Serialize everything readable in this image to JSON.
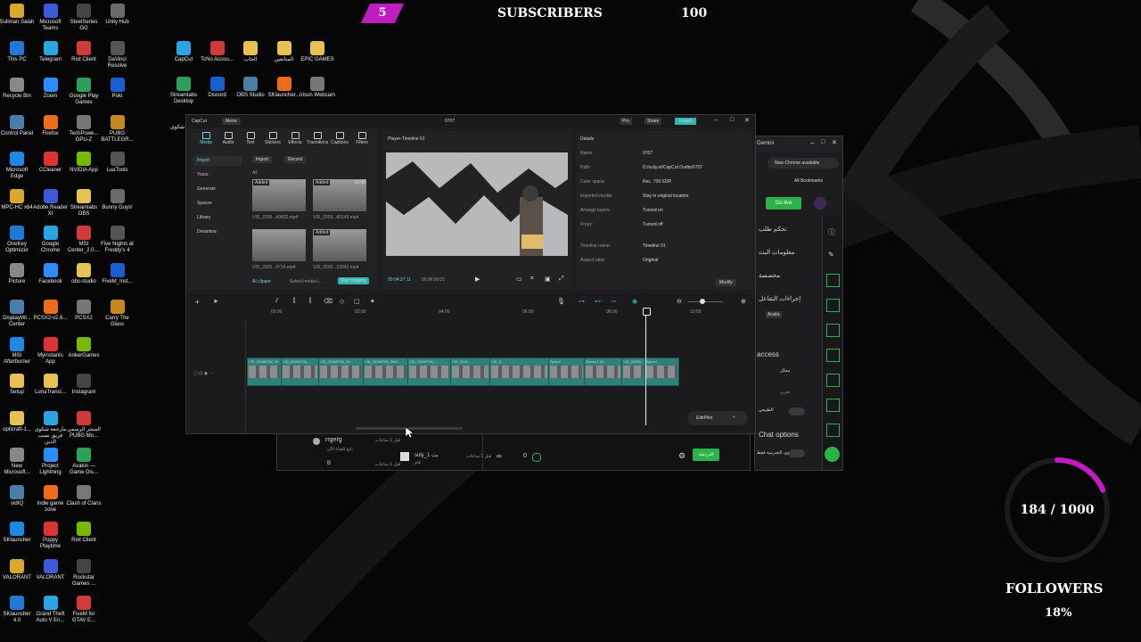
{
  "overlay": {
    "badge_count": "5",
    "subscribers_label": "SUBSCRIBERS",
    "subscribers_value": "100",
    "followers_progress": "184 / 1000",
    "followers_label": "FOLLOWERS",
    "followers_percent": "18%",
    "followers_fraction": 0.184,
    "accent_color": "#c01dc0"
  },
  "desktop": {
    "icons": [
      {
        "label": "Suliman Salah",
        "icon": "user-folder-icon"
      },
      {
        "label": "Microsoft Teams",
        "icon": "teams-icon"
      },
      {
        "label": "SteelSeries GG",
        "icon": "steelseries-icon"
      },
      {
        "label": "Unity Hub",
        "icon": "unity-icon"
      },
      {
        "label": "This PC",
        "icon": "pc-icon"
      },
      {
        "label": "Telegram",
        "icon": "telegram-icon"
      },
      {
        "label": "Riot Client",
        "icon": "riot-icon"
      },
      {
        "label": "DaVinci Resolve",
        "icon": "davinci-icon"
      },
      {
        "label": "Recycle Bin",
        "icon": "recycle-bin-icon"
      },
      {
        "label": "Zoom",
        "icon": "zoom-icon"
      },
      {
        "label": "Google Play Games",
        "icon": "play-games-icon"
      },
      {
        "label": "Poki",
        "icon": "poki-icon"
      },
      {
        "label": "Control Panel",
        "icon": "control-panel-icon"
      },
      {
        "label": "Firefox",
        "icon": "firefox-icon"
      },
      {
        "label": "TechPowe... GPU-Z",
        "icon": "gpuz-icon"
      },
      {
        "label": "PUBG BATTLEGR...",
        "icon": "pubg-icon"
      },
      {
        "label": "Microsoft Edge",
        "icon": "edge-icon"
      },
      {
        "label": "CCleaner",
        "icon": "ccleaner-icon"
      },
      {
        "label": "NVIDIA App",
        "icon": "nvidia-icon"
      },
      {
        "label": "LuaTools",
        "icon": "luatools-icon"
      },
      {
        "label": "MPC-HC x64",
        "icon": "mpc-icon"
      },
      {
        "label": "Adobe Reader XI",
        "icon": "adobe-icon"
      },
      {
        "label": "Streamlabs OBS",
        "icon": "folder-icon"
      },
      {
        "label": "Bunny Guys!",
        "icon": "game-icon"
      },
      {
        "label": "OneKey Optimizer",
        "icon": "onekey-icon"
      },
      {
        "label": "Google Chrome",
        "icon": "chrome-icon"
      },
      {
        "label": "MSI Center_2.0....",
        "icon": "msi-icon"
      },
      {
        "label": "Five Nights at Freddy's 4",
        "icon": "fnaf-icon"
      },
      {
        "label": "Picture",
        "icon": "picture-icon"
      },
      {
        "label": "Facebook",
        "icon": "facebook-icon"
      },
      {
        "label": "obs-studio",
        "icon": "folder-icon"
      },
      {
        "label": "FiveM_Inst...",
        "icon": "fivem-icon"
      },
      {
        "label": "DisplayWi... Center",
        "icon": "display-icon"
      },
      {
        "label": "PCSX2-v2.6...",
        "icon": "pcsx2-icon"
      },
      {
        "label": "PCSX2",
        "icon": "pcsx2-icon"
      },
      {
        "label": "Carry The Glass",
        "icon": "game-icon"
      },
      {
        "label": "MSI Afterburner",
        "icon": "afterburner-icon"
      },
      {
        "label": "Myinstants App",
        "icon": "myinstants-icon"
      },
      {
        "label": "AnkerGames",
        "icon": "anker-icon"
      },
      {
        "label": "",
        "icon": "blank"
      },
      {
        "label": "Setup",
        "icon": "folder-icon"
      },
      {
        "label": "LunaTransl...",
        "icon": "folder-icon"
      },
      {
        "label": "Instagram",
        "icon": "instagram-icon"
      },
      {
        "label": "",
        "icon": "blank"
      },
      {
        "label": "opticraft-1...",
        "icon": "folder-icon"
      },
      {
        "label": "مارجعة شكوى فريق نسب الدين",
        "icon": "document-icon"
      },
      {
        "label": "المتجر الرسمي PUBG Mo...",
        "icon": "pubg-icon"
      },
      {
        "label": "",
        "icon": "blank"
      },
      {
        "label": "New Microsoft...",
        "icon": "document-icon"
      },
      {
        "label": "Project Lightning",
        "icon": "project-icon"
      },
      {
        "label": "Avakin — Game Dis...",
        "icon": "avakin-icon"
      },
      {
        "label": "",
        "icon": "blank"
      },
      {
        "label": "vidIQ",
        "icon": "vidiq-icon"
      },
      {
        "label": "indie game zone",
        "icon": "indie-icon"
      },
      {
        "label": "Clash of Clans",
        "icon": "coc-icon"
      },
      {
        "label": "",
        "icon": "blank"
      },
      {
        "label": "SKlauncher",
        "icon": "sklauncher-icon"
      },
      {
        "label": "Poppy Playtime",
        "icon": "poppy-icon"
      },
      {
        "label": "Riot Client",
        "icon": "riot-icon"
      },
      {
        "label": "",
        "icon": "blank"
      },
      {
        "label": "VALORANT",
        "icon": "valorant-icon"
      },
      {
        "label": "VALORANT",
        "icon": "valorant-icon"
      },
      {
        "label": "Rockstar Games ...",
        "icon": "rockstar-icon"
      },
      {
        "label": "",
        "icon": "blank"
      },
      {
        "label": "SKlauncher 4.0",
        "icon": "sklauncher-icon"
      },
      {
        "label": "Grand Theft Auto V En...",
        "icon": "gta-icon"
      },
      {
        "label": "FiveM for GTAV E...",
        "icon": "fivem-icon"
      }
    ],
    "icons2": [
      {
        "label": "CapCut",
        "icon": "capcut-icon"
      },
      {
        "label": "TcNo Accou...",
        "icon": "tcno-icon"
      },
      {
        "label": "الحاب",
        "icon": "folder-icon"
      },
      {
        "label": "المتابعين",
        "icon": "folder-icon"
      },
      {
        "label": "EPIC GAMES",
        "icon": "folder-icon"
      },
      {
        "label": "Streamlabs Desktop",
        "icon": "streamlabs-icon"
      },
      {
        "label": "Discord",
        "icon": "discord-icon"
      },
      {
        "label": "OBS Studio",
        "icon": "obs-icon"
      },
      {
        "label": "SKlauncher...",
        "icon": "sklauncher-icon"
      },
      {
        "label": "Irisun Webcam",
        "icon": "webcam-icon"
      }
    ],
    "partial_icon_label": "شكوى"
  },
  "capcut": {
    "app_name": "CapCut",
    "menu": "Menu",
    "project_title": "0707",
    "pro": "Pro",
    "share": "Share",
    "export": "Export",
    "toolbar": [
      "Media",
      "Audio",
      "Text",
      "Stickers",
      "Effects",
      "Transitions",
      "Captions",
      "Filters"
    ],
    "side_menu": [
      "Import",
      "Yours",
      "Generate",
      "Spaces",
      "Library",
      "Dreamina"
    ],
    "import_btn": "Import",
    "record_btn": "Record",
    "all_label": "All",
    "media": [
      {
        "name": "VID_2026...49602.mp4",
        "added": "Added",
        "dur": ""
      },
      {
        "name": "VID_2026...85149.mp4",
        "added": "Added",
        "dur": "00:08"
      },
      {
        "name": "VID_2026...9714.mp4",
        "added": "",
        "dur": ""
      },
      {
        "name": "VID_2026...19942.mp4",
        "added": "Added",
        "dur": ""
      }
    ],
    "ai_clipper": "AI clipper",
    "select_media": "Select media t...",
    "start_clipping": "Start clipping",
    "player_title": "Player-Timeline 01",
    "time_current": "00:04:27:11",
    "time_total": "00:06:50:21",
    "details_title": "Details",
    "details": [
      {
        "k": "Name:",
        "v": "0707"
      },
      {
        "k": "Path:",
        "v": "D:/suliy.et/CapCut Drafts/0707"
      },
      {
        "k": "Color space:",
        "v": "Rec. 709 SDR"
      },
      {
        "k": "Imported media:",
        "v": "Stay in original location"
      },
      {
        "k": "Arrange layers:",
        "v": "Turned on"
      },
      {
        "k": "Proxy:",
        "v": "Turned off"
      },
      {
        "k": "Timeline name:",
        "v": "Timeline 01"
      },
      {
        "k": "Aspect ratio:",
        "v": "Original"
      }
    ],
    "modify_btn": "Modify",
    "ruler": [
      "00:00",
      "02:00",
      "04:00",
      "06:00",
      "08:00",
      "10:00"
    ],
    "clips": [
      "VID_20260706_00...",
      "VID_20260706_...",
      "VID_20260706_00...",
      "VID_20260706_2801",
      "VID_20260706_...",
      "VID_2026...",
      "VID_2...",
      "Speed",
      "Speed 1.0X",
      "VID_20260...",
      "Speed"
    ],
    "editpilot": "EditPilot"
  },
  "chrome": {
    "tab_label": "Gemini",
    "notice": "New Chrome available",
    "bookmarks": "All Bookmarks",
    "golive": "Go live",
    "arabic_items": [
      "تحكم طلب",
      "معلومات البث",
      "مخصصة",
      "إجراءات التفاعل"
    ],
    "access": "access",
    "chat_options": "Chat options",
    "setting1": "محلل",
    "setting2": "تحرير",
    "setting3": "الطبيعي",
    "lang": "Arabic",
    "setting4": "المحتوى التجريبية فقط"
  },
  "tiktok": {
    "user1": "rrgerg",
    "user1_sub": "تابع القناة الآن",
    "user1_time": "قبل 1 ساعات",
    "user2": "suly_1 بث",
    "user2_sub": "قام",
    "user2_time": "قبل 1 ساعات",
    "user3": "B",
    "user3_time": "قبل 1 ساعات",
    "viewers": "0",
    "live_btn": "الدردشة"
  }
}
